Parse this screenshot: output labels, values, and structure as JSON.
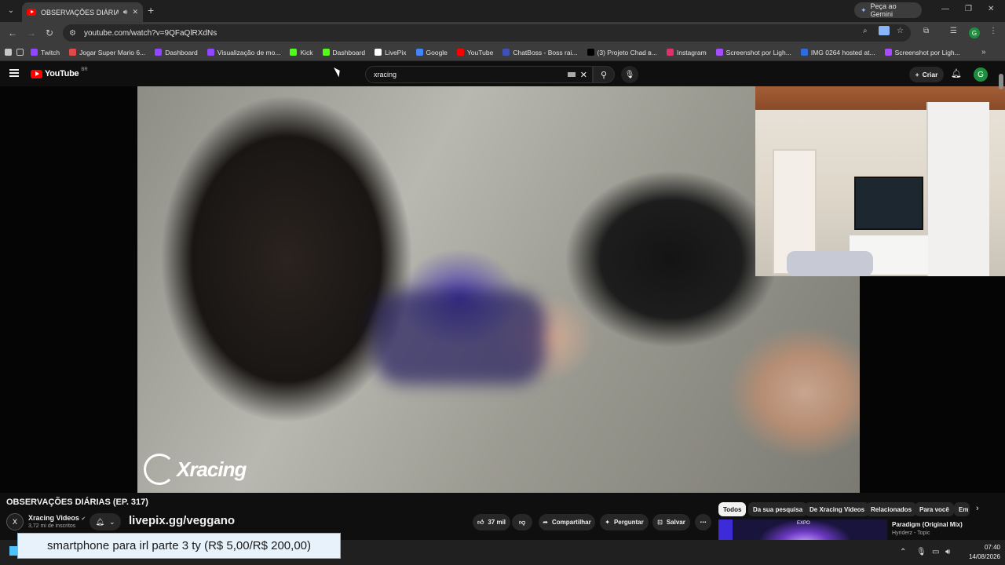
{
  "browser": {
    "tab_title": "OBSERVAÇÕES DIÁRIAS (EP. 317)",
    "url": "youtube.com/watch?v=9QFaQlRXdNs",
    "gemini_label": "Peça ao Gemini",
    "profile_initial": "G",
    "bookmarks": [
      {
        "label": "Twitch",
        "color": "#9146ff"
      },
      {
        "label": "Jogar Super Mario 6...",
        "color": "#e04a4a"
      },
      {
        "label": "Dashboard",
        "color": "#9146ff"
      },
      {
        "label": "Visualização de mo...",
        "color": "#9146ff"
      },
      {
        "label": "Kick",
        "color": "#53fc18"
      },
      {
        "label": "Dashboard",
        "color": "#53fc18"
      },
      {
        "label": "LivePix",
        "color": "#ffffff"
      },
      {
        "label": "Google",
        "color": "#4285f4"
      },
      {
        "label": "YouTube",
        "color": "#ff0000"
      },
      {
        "label": "ChatBoss - Boss rai...",
        "color": "#3f51b5"
      },
      {
        "label": "(3) Projeto Chad в...",
        "color": "#000000"
      },
      {
        "label": "Instagram",
        "color": "#e1306c"
      },
      {
        "label": "Screenshot por Ligh...",
        "color": "#a64dff"
      },
      {
        "label": "IMG 0264 hosted at...",
        "color": "#2d6cdf"
      },
      {
        "label": "Screenshot por Ligh...",
        "color": "#a64dff"
      }
    ]
  },
  "youtube": {
    "logo_text": "YouTube",
    "logo_country": "BR",
    "search_value": "xracing",
    "create_label": "Criar",
    "avatar_initial": "G"
  },
  "video": {
    "watermark": "Xracing",
    "title": "OBSERVAÇÕES DIÁRIAS (EP. 317)",
    "channel_name": "Xracing Videos",
    "subscribers": "3,72 mi de inscritos",
    "channel_initial": "X",
    "pix_link": "livepix.gg/veggano",
    "likes": "37 mil",
    "share_label": "Compartilhar",
    "ask_label": "Perguntar",
    "save_label": "Salvar"
  },
  "chips": [
    "Todos",
    "Da sua pesquisa",
    "De Xracing Videos",
    "Relacionados",
    "Para você",
    "Em"
  ],
  "related": {
    "title": "Paradigm (Original Mix)",
    "channel": "Hyriderz - Topic",
    "thumb_label": "EXPO"
  },
  "donation": {
    "text": "smartphone para irl parte 3 ty (R$ 5,00/R$ 200,00)"
  },
  "taskbar": {
    "time": "07:40",
    "date": "14/08/2026"
  },
  "colors": {
    "yt_red": "#ff0000",
    "background": "#0f0f0f",
    "chip_active": "#f1f1f1"
  }
}
